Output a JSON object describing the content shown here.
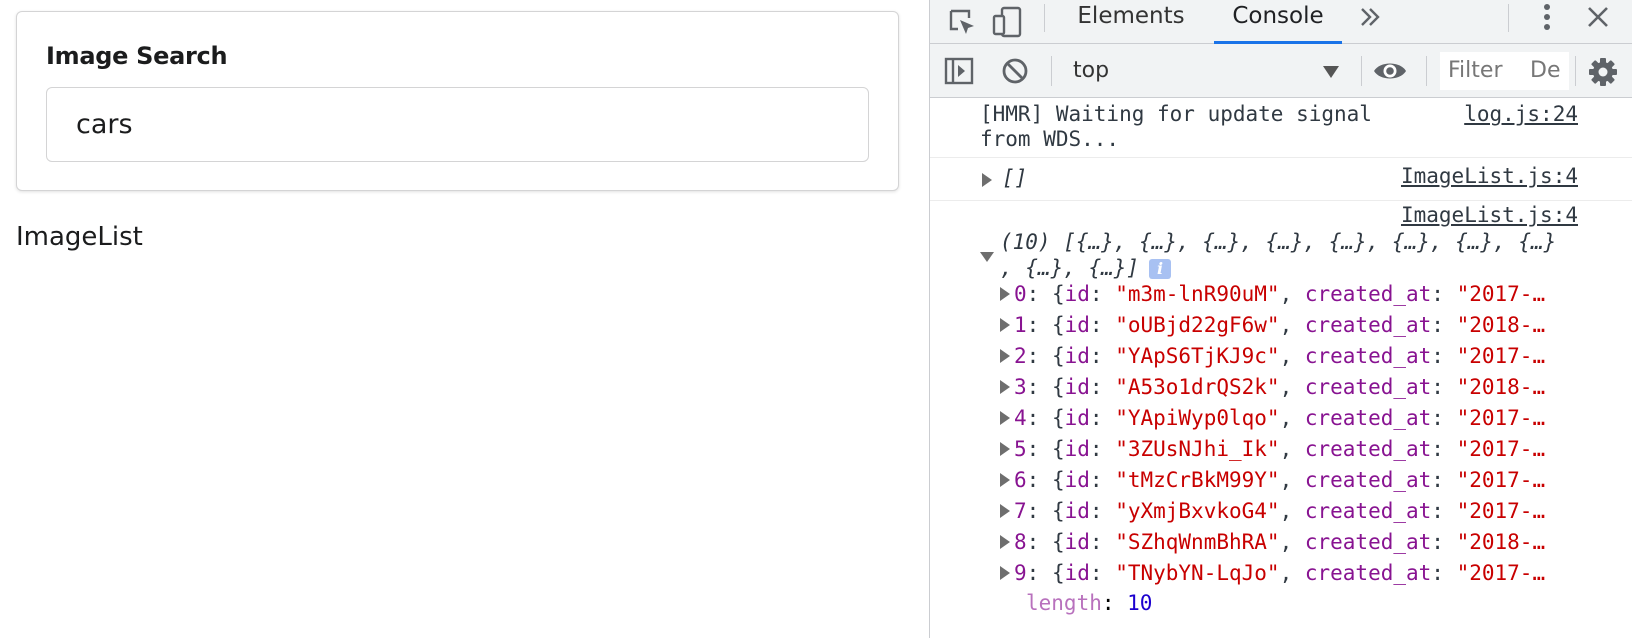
{
  "app": {
    "search_label": "Image Search",
    "search_value": "cars",
    "image_list_text": "ImageList"
  },
  "devtools": {
    "tabs": [
      {
        "label": "Elements",
        "active": false
      },
      {
        "label": "Console",
        "active": true
      }
    ],
    "more_tabs_icon": "double-chevron-right-icon",
    "context": "top",
    "filter_placeholder": "Filter",
    "levels_label": "De",
    "accent_color": "#1a73e8",
    "messages": {
      "hmr": {
        "text_line1": "[HMR] Waiting for update signal",
        "text_line2": "from WDS...",
        "source": "log.js:24"
      },
      "empty_array": {
        "text": "[]",
        "source": "ImageList.js:4"
      },
      "array": {
        "source": "ImageList.js:4",
        "summary_line1": "(10) [{…}, {…}, {…}, {…}, {…}, {…}, {…}, {…}",
        "summary_line2": ", {…}, {…}]",
        "info_badge": "i",
        "items": [
          {
            "index": "0",
            "id": "\"m3m-lnR90uM\"",
            "created": "\"2017-…"
          },
          {
            "index": "1",
            "id": "\"oUBjd22gF6w\"",
            "created": "\"2018-…"
          },
          {
            "index": "2",
            "id": "\"YApS6TjKJ9c\"",
            "created": "\"2017-…"
          },
          {
            "index": "3",
            "id": "\"A53o1drQS2k\"",
            "created": "\"2018-…"
          },
          {
            "index": "4",
            "id": "\"YApiWyp0lqo\"",
            "created": "\"2017-…"
          },
          {
            "index": "5",
            "id": "\"3ZUsNJhi_Ik\"",
            "created": "\"2017-…"
          },
          {
            "index": "6",
            "id": "\"tMzCrBkM99Y\"",
            "created": "\"2017-…"
          },
          {
            "index": "7",
            "id": "\"yXmjBxvkoG4\"",
            "created": "\"2017-…"
          },
          {
            "index": "8",
            "id": "\"SZhqWnmBhRA\"",
            "created": "\"2018-…"
          },
          {
            "index": "9",
            "id": "\"TNybYN-LqJo\"",
            "created": "\"2017-…"
          }
        ],
        "length_key": "length",
        "length_value": "10"
      }
    }
  }
}
